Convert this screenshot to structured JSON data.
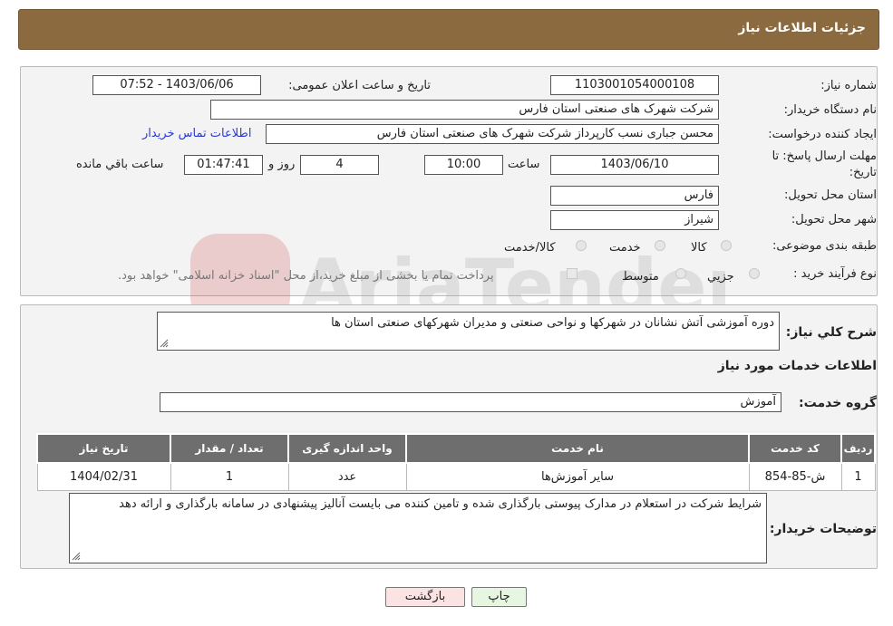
{
  "header": {
    "title": "جزئیات اطلاعات نیاز"
  },
  "form": {
    "need_number_label": "شماره نیاز:",
    "need_number": "1103001054000108",
    "announce_label": "تاریخ و ساعت اعلان عمومی:",
    "announce_value": "1403/06/06 - 07:52",
    "buyer_label": "نام دستگاه خریدار:",
    "buyer_value": "شرکت شهرک های صنعتی استان فارس",
    "creator_label": "ایجاد کننده درخواست:",
    "creator_value": "محسن  جباری نسب کارپرداز شرکت شهرک های صنعتی استان فارس",
    "contact_link": "اطلاعات تماس خریدار",
    "deadline_label_1": "مهلت ارسال پاسخ: تا",
    "deadline_label_2": "تاریخ:",
    "deadline_date": "1403/06/10",
    "time_label": "ساعت",
    "deadline_time": "10:00",
    "days_value": "4",
    "days_label": "روز و",
    "remaining_time": "01:47:41",
    "remaining_label": "ساعت باقي مانده",
    "province_label": "استان محل تحویل:",
    "province_value": "فارس",
    "city_label": "شهر محل تحویل:",
    "city_value": "شیراز",
    "category_label": "طبقه بندی موضوعی:",
    "category_options": [
      "کالا",
      "خدمت",
      "کالا/خدمت"
    ],
    "process_label": "نوع فرآیند خرید :",
    "process_options": [
      "جزیي",
      "متوسط"
    ],
    "payment_note": "پرداخت تمام یا بخشی از مبلغ خرید،از محل \"اسناد خزانه اسلامی\" خواهد بود."
  },
  "summary": {
    "label": "شرح کلي نياز:",
    "value": "دوره آموزشی آتش نشانان در شهرکها و نواحی صنعتی و مدیران شهرکهای صنعتی استان ها",
    "services_title": "اطلاعات خدمات مورد نياز",
    "group_label": "گروه خدمت:",
    "group_value": "آموزش"
  },
  "table": {
    "headers": [
      "ردیف",
      "کد خدمت",
      "نام خدمت",
      "واحد اندازه گیری",
      "تعداد / مقدار",
      "تاریخ نیاز"
    ],
    "rows": [
      [
        "1",
        "ش-85-854",
        "سایر آموزش‌ها",
        "عدد",
        "1",
        "1404/02/31"
      ]
    ]
  },
  "notes": {
    "label": "توضیحات خریدار:",
    "value": "شرایط شرکت در استعلام در مدارک پیوستی بارگذاری شده و تامین کننده می بایست آنالیز پیشنهادی در سامانه بارگذاری و ارائه دهد"
  },
  "buttons": {
    "print": "چاپ",
    "back": "بازگشت"
  },
  "colors": {
    "header_bg": "#8b6a3f",
    "table_header": "#6e6e6e",
    "link": "#2a3bd6",
    "back_button": "#fbe3e3",
    "print_button": "#e6f6e0"
  }
}
